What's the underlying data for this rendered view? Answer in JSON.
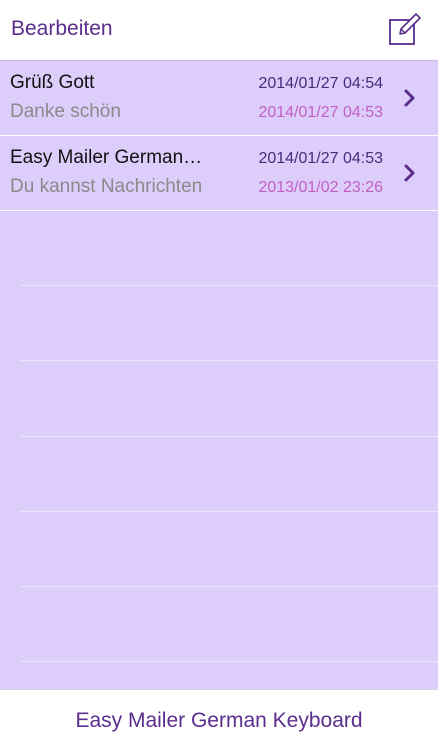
{
  "nav": {
    "edit_label": "Bearbeiten",
    "compose_icon": "compose-icon"
  },
  "messages": [
    {
      "title": "Grüß Gott",
      "subtitle": "Danke schön",
      "date_primary": "2014/01/27 04:54",
      "date_secondary": "2014/01/27 04:53"
    },
    {
      "title": "Easy Mailer German…",
      "subtitle": "Du kannst Nachrichten",
      "date_primary": "2014/01/27 04:53",
      "date_secondary": "2013/01/02 23:26"
    }
  ],
  "footer": {
    "label": "Easy Mailer German Keyboard"
  },
  "colors": {
    "accent": "#5b2d8e",
    "list_background": "#dccdfb",
    "date_secondary": "#c25fc4"
  }
}
